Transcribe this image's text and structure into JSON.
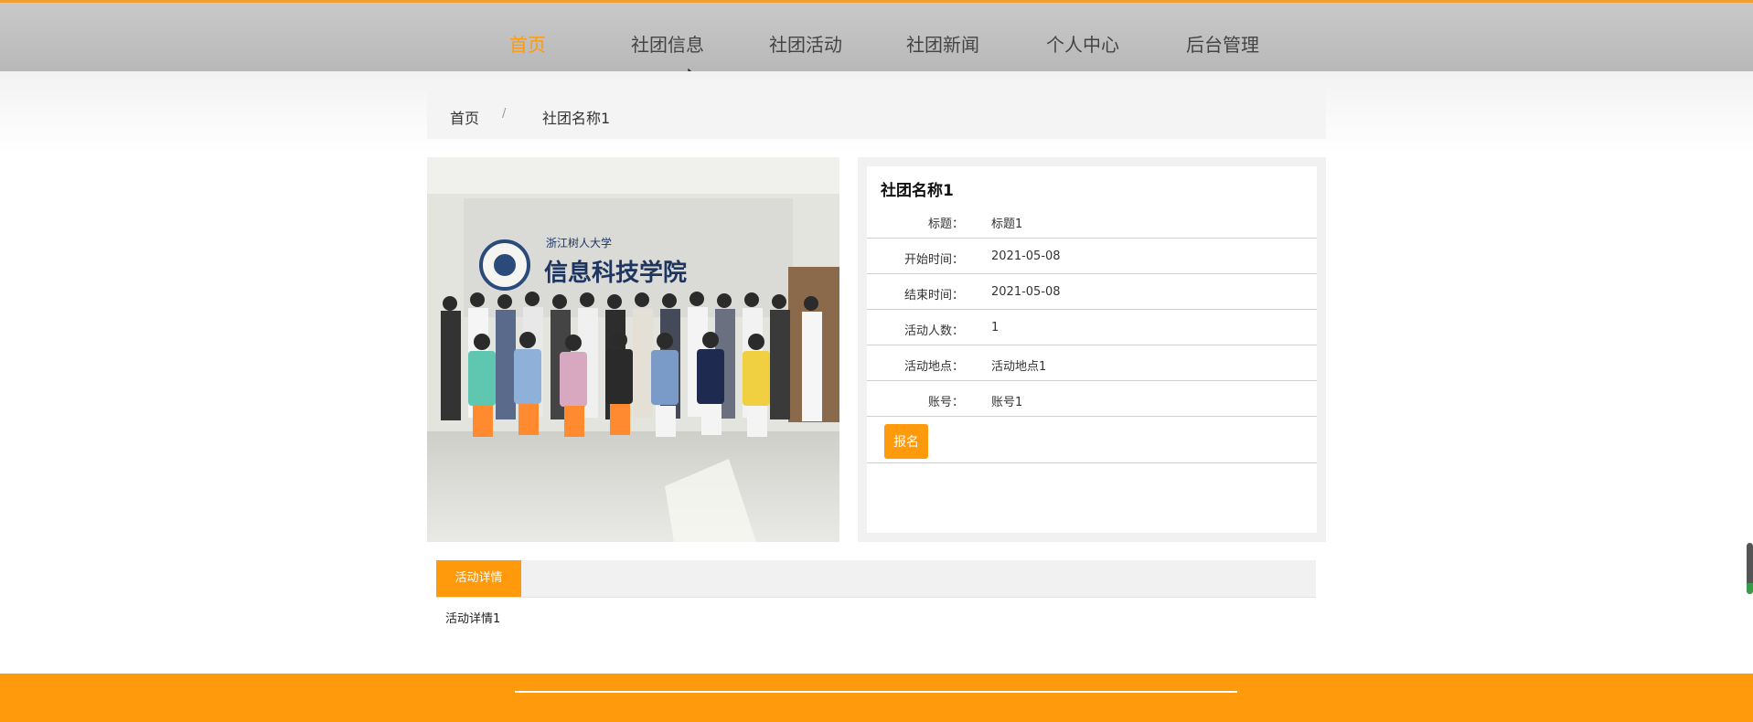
{
  "nav": {
    "items": [
      {
        "label": "首页",
        "active": true
      },
      {
        "label": "社团信息",
        "active": false
      },
      {
        "label": "社团活动",
        "active": false
      },
      {
        "label": "社团新闻",
        "active": false
      },
      {
        "label": "个人中心",
        "active": false
      },
      {
        "label": "后台管理",
        "active": false
      }
    ]
  },
  "breadcrumb": {
    "home": "首页",
    "separator": "/",
    "current": "社团名称1"
  },
  "photo": {
    "sign_text": "信息科技学院",
    "sign_small": "浙江树人大学"
  },
  "info": {
    "title": "社团名称1",
    "rows": [
      {
        "label": "标题：",
        "value": "标题1"
      },
      {
        "label": "开始时间：",
        "value": "2021-05-08"
      },
      {
        "label": "结束时间：",
        "value": "2021-05-08"
      },
      {
        "label": "活动人数：",
        "value": "1"
      },
      {
        "label": "活动地点：",
        "value": "活动地点1"
      },
      {
        "label": "账号：",
        "value": "账号1"
      }
    ],
    "signup_label": "报名"
  },
  "tabs": {
    "active_label": "活动详情",
    "content": "活动详情1"
  },
  "colors": {
    "accent": "#ff9a0d",
    "nav_bg": "#bdbdbd"
  }
}
